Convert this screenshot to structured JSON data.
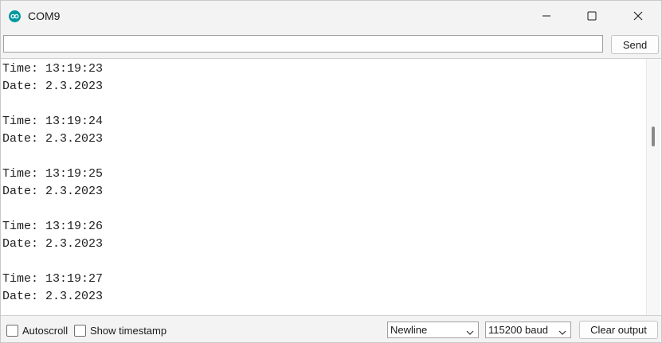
{
  "window": {
    "title": "COM9",
    "icon": "arduino-icon",
    "controls": [
      "minimize-icon",
      "maximize-icon",
      "close-icon"
    ]
  },
  "send_row": {
    "input_value": "",
    "input_placeholder": "",
    "send_label": "Send"
  },
  "output": {
    "lines": [
      "Time: 13:19:23",
      "Date: 2.3.2023",
      "",
      "Time: 13:19:24",
      "Date: 2.3.2023",
      "",
      "Time: 13:19:25",
      "Date: 2.3.2023",
      "",
      "Time: 13:19:26",
      "Date: 2.3.2023",
      "",
      "Time: 13:19:27",
      "Date: 2.3.2023"
    ]
  },
  "bottom": {
    "autoscroll_label": "Autoscroll",
    "autoscroll_checked": false,
    "timestamp_label": "Show timestamp",
    "timestamp_checked": false,
    "line_ending": "Newline",
    "baud_rate": "115200 baud",
    "clear_label": "Clear output"
  },
  "colors": {
    "accent": "#00979d",
    "window_bg": "#f3f3f3",
    "output_bg": "#ffffff"
  }
}
